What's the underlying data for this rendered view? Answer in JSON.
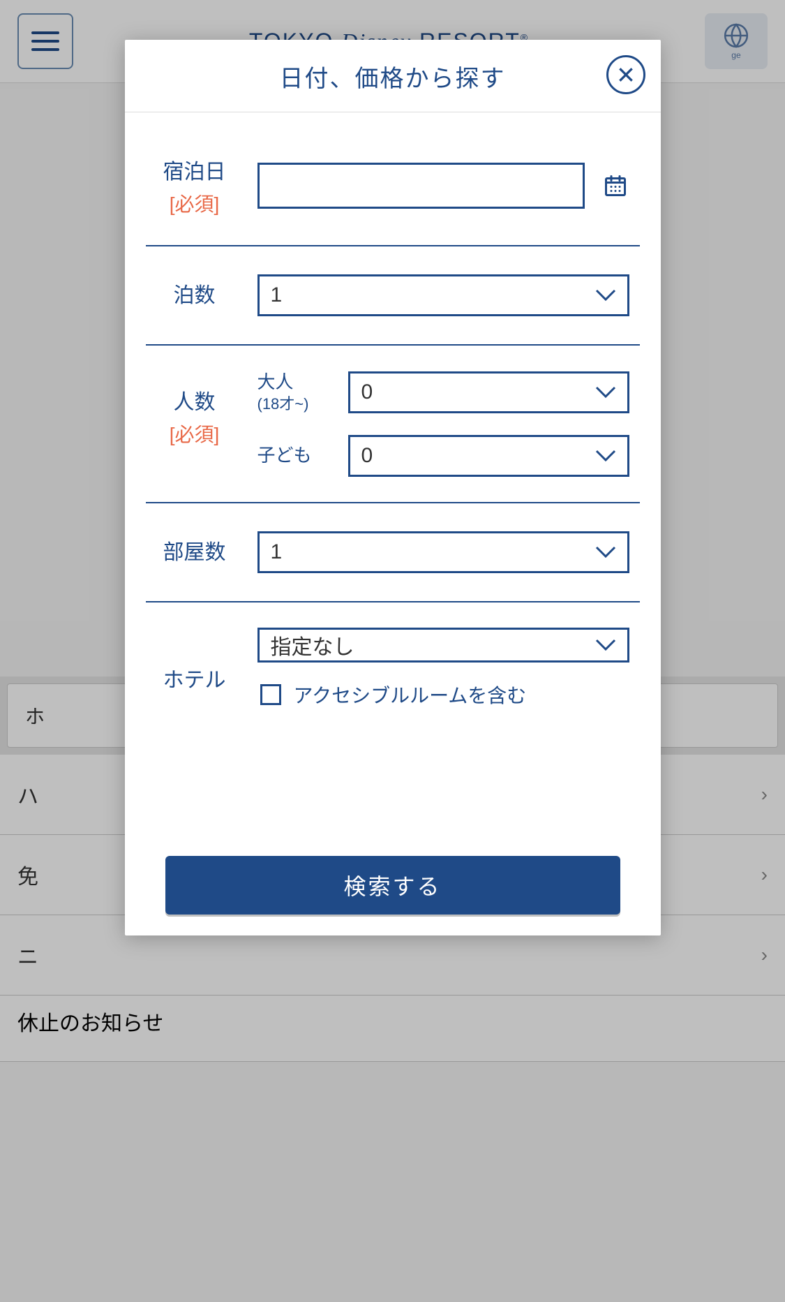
{
  "header": {
    "brand_prefix": "TOKYO",
    "brand_mid": "Disney",
    "brand_suffix": "RESORT",
    "brand_r": "®",
    "lang_label": "ge"
  },
  "bg": {
    "tab1": "ホ",
    "item1": "ハ",
    "item2": "免",
    "item3_line1": "ニ",
    "item3_line2": "休止のお知らせ"
  },
  "modal": {
    "title": "日付、価格から探す",
    "date_label": "宿泊日",
    "required": "[必須]",
    "nights_label": "泊数",
    "nights_value": "1",
    "people_label": "人数",
    "adult_label": "大人",
    "adult_age": "(18才~)",
    "adult_value": "0",
    "child_label": "子ども",
    "child_value": "0",
    "rooms_label": "部屋数",
    "rooms_value": "1",
    "hotel_label": "ホテル",
    "hotel_value": "指定なし",
    "accessible_label": "アクセシブルルームを含む",
    "search_button": "検索する"
  }
}
